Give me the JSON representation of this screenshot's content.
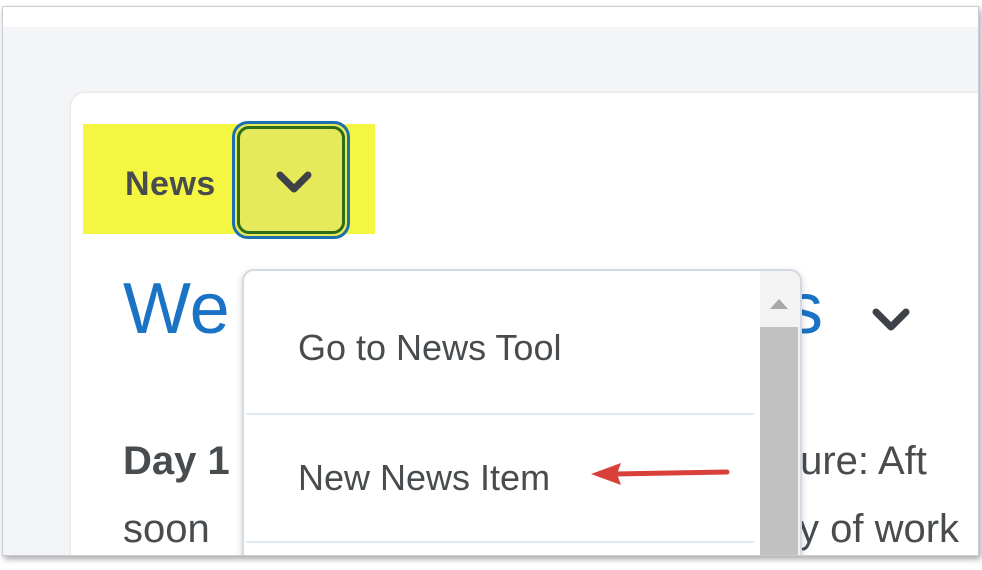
{
  "widget": {
    "name": "News",
    "title_start": "We",
    "title_end": "s"
  },
  "content": {
    "line1_bold": "Day 1",
    "line1_right": "ture: Aft",
    "line2_left": "soon",
    "line2_right": "y of work"
  },
  "dropdown_menu": {
    "items": [
      {
        "label": "Go to News Tool"
      },
      {
        "label": "New News Item"
      }
    ]
  },
  "colors": {
    "highlight": "#f5f642",
    "title_blue": "#1a73c4",
    "arrow_red": "#d9403a"
  }
}
